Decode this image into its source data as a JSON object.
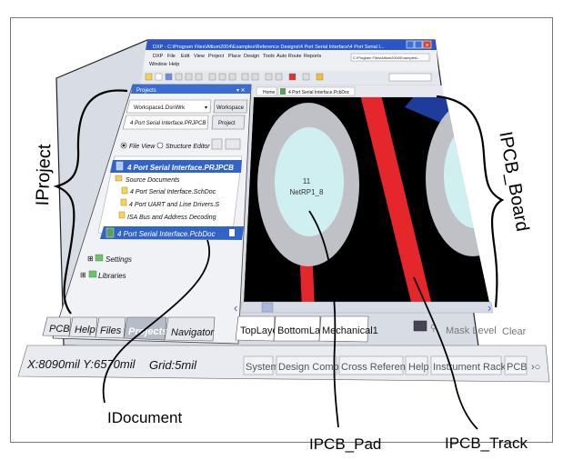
{
  "window": {
    "title": "DXP - C:\\Program Files\\Altium2004\\Examples\\Reference Designs\\4 Port Serial Interface\\4 Port Serial I...",
    "menu_row1": [
      "DXP",
      "File",
      "Edit",
      "View",
      "Project",
      "Place",
      "Design",
      "Tools",
      "Auto Route",
      "Reports"
    ],
    "menu_row2": [
      "Window",
      "Help"
    ],
    "path_text": "C:\\Program Files\\Altium2004\\Examples\\..."
  },
  "projects_panel": {
    "title": "Projects",
    "workspace_value": "Workspace1.DsnWrk",
    "workspace_button": "Workspace",
    "project_value": "4 Port Serial Interface.PRJPCB",
    "project_button": "Project",
    "view_file": "File View",
    "view_structure": "Structure Editor",
    "tree": [
      "4 Port Serial Interface.PRJPCB",
      "Source Documents",
      "4 Port Serial Interface.SchDoc",
      "4 Port UART and Line Drivers.S",
      "ISA Bus and Address Decoding",
      "4 Port Serial Interface.PcbDoc",
      "Settings",
      "Libraries"
    ],
    "tabs": [
      "PCB",
      "Help",
      "Files",
      "Projects",
      "Navigator"
    ]
  },
  "editor": {
    "tabs": [
      "Home",
      "4 Port Serial Interface.PcbDoc"
    ],
    "pad_designator": "11",
    "pad_net": "NetRP1_8",
    "layer_tabs": [
      "TopLayer",
      "BottomLayer",
      "Mechanical1"
    ],
    "mask_level": "Mask Level",
    "clear": "Clear"
  },
  "status_bar": {
    "coords": "X:8090mil Y:6570mil",
    "grid": "Grid:5mil",
    "buttons": [
      "System",
      "Design Compiler",
      "Cross References",
      "Help",
      "Instrument Racks",
      "PCB"
    ]
  },
  "callouts": {
    "iproject": "IProject",
    "ipcb_board": "IPCB_Board",
    "idocument": "IDocument",
    "ipcb_pad": "IPCB_Pad",
    "ipcb_track": "IPCB_Track"
  },
  "colors": {
    "board_bg": "#000000",
    "track_red": "#e5262a",
    "track_blue": "#1f3b9c",
    "pad_outer": "#bfc1c6",
    "pad_inner": "#cfeff0",
    "selection": "#3264c8",
    "titlebar": "#2a56c8"
  }
}
